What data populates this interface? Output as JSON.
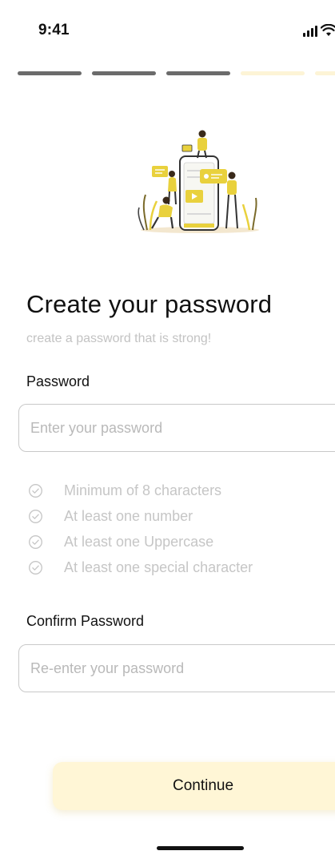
{
  "status_bar": {
    "time": "9:41"
  },
  "progress": {
    "total_steps": 5,
    "completed_steps": 3,
    "active_color": "#6b6b6b",
    "inactive_color": "#fdf4d6"
  },
  "illustration": {
    "accent_color": "#e9d13d"
  },
  "header": {
    "title": "Create your password",
    "subtitle": "create a password that is strong!"
  },
  "password": {
    "label": "Password",
    "placeholder": "Enter your password",
    "value": ""
  },
  "requirements": [
    {
      "text": "Minimum of 8 characters",
      "icon": "check-circle-icon",
      "met": false
    },
    {
      "text": "At least one number",
      "icon": "check-circle-icon",
      "met": false
    },
    {
      "text": "At least one Uppercase",
      "icon": "check-circle-icon",
      "met": false
    },
    {
      "text": "At least one special character",
      "icon": "check-circle-icon",
      "met": false
    }
  ],
  "confirm_password": {
    "label": "Confirm Password",
    "placeholder": "Re-enter your password",
    "value": ""
  },
  "actions": {
    "continue_label": "Continue",
    "continue_color": "#fff6d6"
  }
}
